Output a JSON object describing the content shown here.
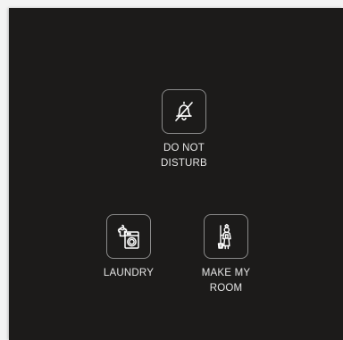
{
  "controls": [
    {
      "id": "dnd",
      "label": "DO NOT\nDISTURB",
      "icon": "bell-off-icon"
    },
    {
      "id": "laundry",
      "label": "LAUNDRY",
      "icon": "washing-machine-icon"
    },
    {
      "id": "room",
      "label": "MAKE MY\nROOM",
      "icon": "housekeeper-icon"
    }
  ],
  "colors": {
    "panel_bg": "#1c1b1a",
    "border": "#8a8a8a",
    "icon": "#ffffff",
    "text": "#e6e6e6"
  }
}
